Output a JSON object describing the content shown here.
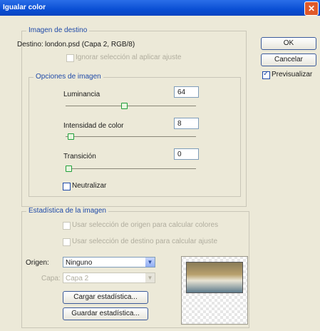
{
  "window": {
    "title": "Igualar color",
    "close_symbol": "✕"
  },
  "buttons": {
    "ok": "OK",
    "cancel": "Cancelar"
  },
  "preview": {
    "label": "Previsualizar",
    "checked": true
  },
  "target_image": {
    "legend": "Imagen de destino",
    "destination_label": "Destino:",
    "destination_value": "london.psd (Capa 2, RGB/8)",
    "ignore_selection_label": "Ignorar selección al aplicar ajuste"
  },
  "image_options": {
    "legend": "Opciones de imagen",
    "luminance": {
      "label": "Luminancia",
      "value": "64",
      "slider_fraction": 0.45
    },
    "color_intensity": {
      "label": "Intensidad de color",
      "value": "8",
      "slider_fraction": 0.02
    },
    "fade": {
      "label": "Transición",
      "value": "0",
      "slider_fraction": 0.0
    },
    "neutralize_label": "Neutralizar"
  },
  "image_statistics": {
    "legend": "Estadística de la imagen",
    "use_source_selection": "Usar selección de origen para calcular colores",
    "use_target_selection": "Usar selección de destino para calcular ajuste",
    "source_label": "Origen:",
    "source_value": "Ninguno",
    "layer_label": "Capa:",
    "layer_value": "Capa 2",
    "load_stats": "Cargar estadística...",
    "save_stats": "Guardar estadística..."
  },
  "icons": {
    "dropdown": "chevron-down-icon",
    "close": "close-icon"
  }
}
